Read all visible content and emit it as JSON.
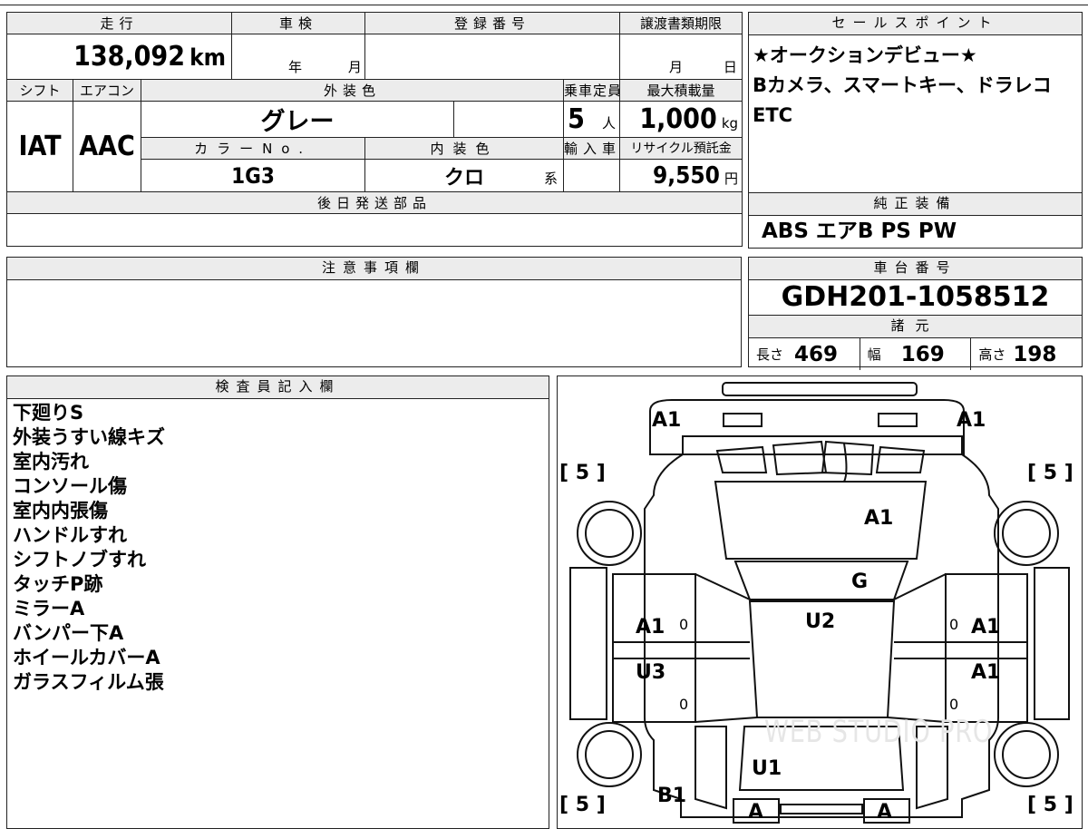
{
  "main_table": {
    "mileage_label": "走行",
    "mileage_value": "138,092",
    "mileage_unit": "km",
    "inspection_label": "車検",
    "inspection_year": "年",
    "inspection_month": "月",
    "registration_label": "登録番号",
    "registration_value": "",
    "transfer_label": "譲渡書類期限",
    "transfer_month": "月",
    "transfer_day": "日",
    "shift_label": "シフト",
    "shift_value": "IAT",
    "ac_label": "エアコン",
    "ac_value": "AAC",
    "exterior_label": "外装色",
    "exterior_value": "グレー",
    "capacity_label": "乗車定員",
    "capacity_value": "5",
    "capacity_unit": "人",
    "load_label": "最大積載量",
    "load_value": "1,000",
    "load_unit": "kg",
    "color_no_label": "カラーNo.",
    "color_no_value": "1G3",
    "interior_label": "内装色",
    "interior_value": "クロ",
    "interior_suffix": "系",
    "import_label": "輸入車",
    "recycle_label": "リサイクル預託金",
    "recycle_value": "9,550",
    "recycle_unit": "円",
    "later_parts_label": "後日発送部品"
  },
  "sales_point": {
    "title": "セールスポイント",
    "lines": [
      "★オークションデビュー★",
      "Bカメラ、スマートキー、ドラレコ",
      "ETC"
    ]
  },
  "genuine_equipment": {
    "title": "純正装備",
    "value": "ABS エアB PS PW"
  },
  "caution": {
    "title": "注意事項欄"
  },
  "chassis": {
    "title": "車台番号",
    "value": "GDH201-1058512",
    "specs_title": "諸元",
    "length_label": "長さ",
    "length_value": "469",
    "width_label": "幅",
    "width_value": "169",
    "height_label": "高さ",
    "height_value": "198"
  },
  "inspector": {
    "title": "検査員記入欄",
    "notes": [
      "下廻りS",
      "外装うすい線キズ",
      "室内汚れ",
      "コンソール傷",
      "室内内張傷",
      "ハンドルすれ",
      "シフトノブすれ",
      "タッチP跡",
      "ミラーA",
      "バンパー下A",
      "ホイールカバーA",
      "ガラスフィルム張"
    ]
  },
  "diagram": {
    "watermark": "WEB STUDIO PRO",
    "marks": {
      "front_left": "A1",
      "front_right": "A1",
      "bracket_top_left": "5",
      "bracket_top_right": "5",
      "bracket_bottom_left": "5",
      "bracket_bottom_right": "5",
      "windshield": "A1",
      "hood": "G",
      "roof": "U2",
      "left_door_front": "A1",
      "left_door_rear": "U3",
      "right_door_front": "A1",
      "right_door_rear": "A1",
      "rear_floor": "U1",
      "rear_left": "B1",
      "rear_a_left": "A",
      "rear_a_right": "A",
      "zero_1": "0",
      "zero_2": "0",
      "zero_3": "0",
      "zero_4": "0"
    }
  }
}
